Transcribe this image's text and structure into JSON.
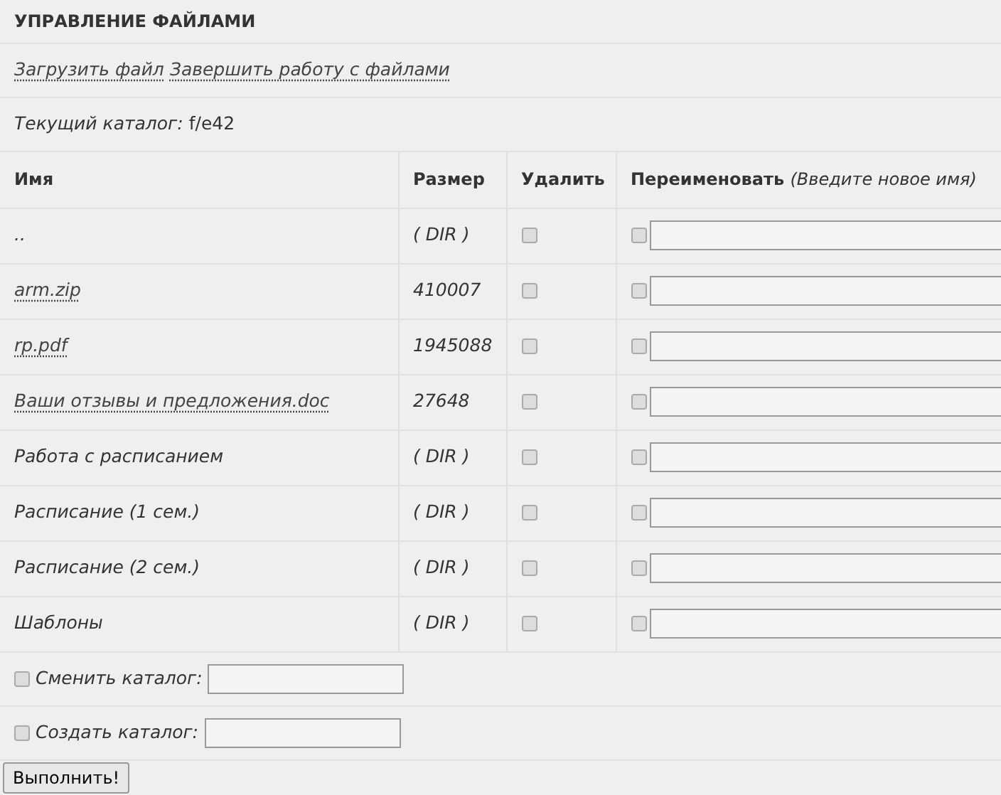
{
  "title": "УПРАВЛЕНИЕ ФАЙЛАМИ",
  "actions": [
    {
      "label": "Загрузить файл"
    },
    {
      "label": "Завершить работу с файлами"
    }
  ],
  "current_dir": {
    "label": "Текущий каталог:",
    "value": "f/e42"
  },
  "columns": [
    {
      "label": "Имя"
    },
    {
      "label": "Размер"
    },
    {
      "label": "Удалить"
    },
    {
      "label": "Переименовать",
      "hint": "(Введите новое имя)"
    }
  ],
  "rows": [
    {
      "name": "..",
      "link": false,
      "size": "( DIR )",
      "delete": false,
      "rename": false
    },
    {
      "name": "arm.zip",
      "link": true,
      "size": "410007",
      "delete": false,
      "rename": false
    },
    {
      "name": "rp.pdf",
      "link": true,
      "size": "1945088",
      "delete": false,
      "rename": false
    },
    {
      "name": "Ваши отзывы и предложения.doc",
      "link": true,
      "size": "27648",
      "delete": false,
      "rename": false
    },
    {
      "name": "Работа с расписанием",
      "link": false,
      "size": "( DIR )",
      "delete": false,
      "rename": false
    },
    {
      "name": "Расписание (1 сем.)",
      "link": false,
      "size": "( DIR )",
      "delete": false,
      "rename": false
    },
    {
      "name": "Расписание (2 сем.)",
      "link": false,
      "size": "( DIR )",
      "delete": false,
      "rename": false
    },
    {
      "name": "Шаблоны",
      "link": false,
      "size": "( DIR )",
      "delete": false,
      "rename": false
    }
  ],
  "options": [
    {
      "label": "Сменить каталог:",
      "checked": false
    },
    {
      "label": "Создать каталог:",
      "checked": false
    }
  ],
  "submit": "Выполнить!"
}
